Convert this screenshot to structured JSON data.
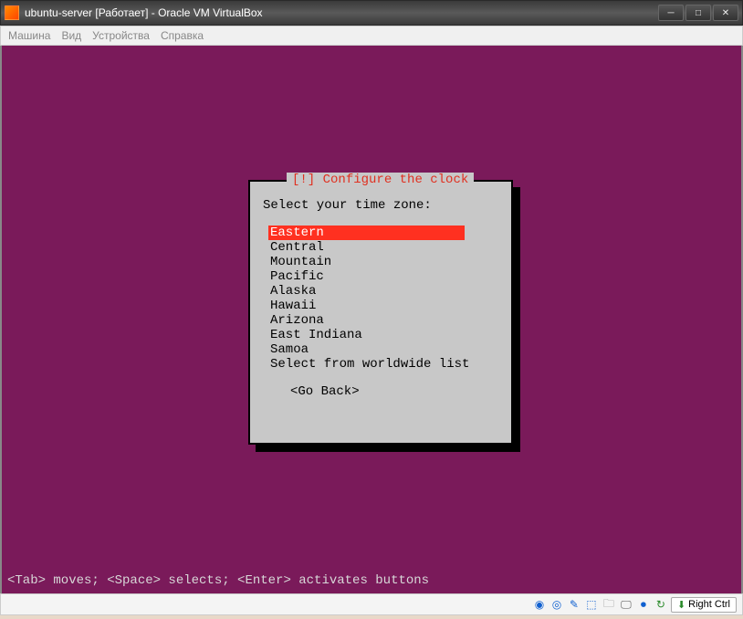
{
  "window": {
    "title": "ubuntu-server [Работает] - Oracle VM VirtualBox"
  },
  "menubar": {
    "items": [
      "Машина",
      "Вид",
      "Устройства",
      "Справка"
    ]
  },
  "dialog": {
    "title_prefix": "[!]",
    "title": "Configure the clock",
    "prompt": "Select your time zone:",
    "timezones": [
      "Eastern",
      "Central",
      "Mountain",
      "Pacific",
      "Alaska",
      "Hawaii",
      "Arizona",
      "East Indiana",
      "Samoa",
      "Select from worldwide list"
    ],
    "selected_index": 0,
    "go_back": "<Go Back>"
  },
  "hint": "<Tab> moves; <Space> selects; <Enter> activates buttons",
  "statusbar": {
    "host_key": "Right Ctrl"
  }
}
